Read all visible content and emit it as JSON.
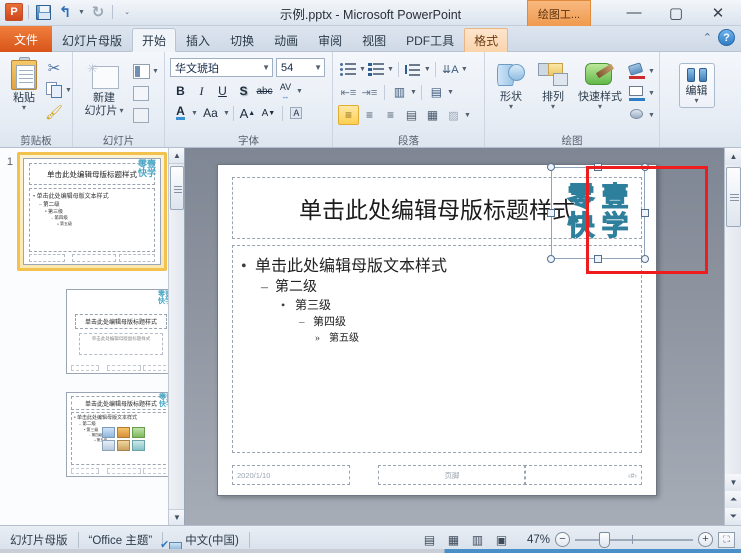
{
  "window": {
    "title": "示例.pptx  -  Microsoft PowerPoint",
    "contextual_tab_group": "绘图工...",
    "minimize": "—",
    "maximize": "▢",
    "close": "✕"
  },
  "quick_access": {
    "app_logo": "P",
    "items": [
      {
        "name": "save-icon",
        "label": "保存"
      },
      {
        "name": "undo-icon",
        "label": "撤消",
        "glyph": "↰"
      },
      {
        "name": "redo-icon",
        "label": "恢复",
        "glyph": "↻"
      },
      {
        "name": "customize-icon",
        "label": "自定义快速访问工具栏",
        "glyph": "▾"
      }
    ]
  },
  "tabs": {
    "file": "文件",
    "items": [
      {
        "label": "幻灯片母版",
        "active": false
      },
      {
        "label": "开始",
        "active": true
      },
      {
        "label": "插入",
        "active": false
      },
      {
        "label": "切换",
        "active": false
      },
      {
        "label": "动画",
        "active": false
      },
      {
        "label": "审阅",
        "active": false
      },
      {
        "label": "视图",
        "active": false
      },
      {
        "label": "PDF工具",
        "active": false
      }
    ],
    "contextual": "格式",
    "minimize_ribbon": "⌃",
    "help": "?"
  },
  "ribbon": {
    "groups": [
      {
        "name": "clipboard",
        "label": "剪贴板"
      },
      {
        "name": "slides",
        "label": "幻灯片"
      },
      {
        "name": "font",
        "label": "字体"
      },
      {
        "name": "paragraph",
        "label": "段落"
      },
      {
        "name": "drawing",
        "label": "绘图"
      },
      {
        "name": "editing",
        "label": "编辑"
      }
    ],
    "clipboard": {
      "paste_label": "粘贴",
      "paste_caret": "▾",
      "cut_icon": "✂",
      "copy_icon": "copy",
      "format_painter_icon": "brush",
      "dialog_launcher": "⌐"
    },
    "slides": {
      "new_slide_label_line1": "新建",
      "new_slide_label_line2": "幻灯片",
      "new_slide_caret": "▾",
      "layout_icon": "layout",
      "reset_icon": "reset",
      "section_icon": "section"
    },
    "font": {
      "font_name": "华文琥珀",
      "font_size": "54",
      "bold": "B",
      "italic": "I",
      "underline": "U",
      "shadow": "S",
      "strikethrough": "abc",
      "char_spacing": "AV",
      "font_color": "A",
      "change_case": "Aa",
      "grow_font": "A",
      "shrink_font": "A",
      "clear_format": "A",
      "dialog_launcher": "⌐"
    },
    "paragraph": {
      "bullets": "bullets",
      "numbering": "numbering",
      "line_spacing": "line-spacing",
      "text_direction": "text-direction",
      "decrease_indent": "decrease-indent",
      "increase_indent": "increase-indent",
      "align_columns": "columns",
      "align_text": "align-text",
      "align_left": "align-left",
      "align_center": "align-center",
      "align_right": "align-right",
      "justify": "justify",
      "smartart": "smartart",
      "convert_smartart": "convert-smartart",
      "dialog_launcher": "⌐"
    },
    "drawing": {
      "shapes_label": "形状",
      "arrange_label": "排列",
      "quickstyles_label": "快速样式",
      "caret": "▾",
      "shape_fill": "shape-fill",
      "shape_outline": "shape-outline",
      "shape_effects": "shape-effects",
      "dialog_launcher": "⌐"
    },
    "editing": {
      "label": "编辑",
      "caret": "▾"
    }
  },
  "slide_panel": {
    "thumbnails": [
      {
        "number": "1",
        "selected": true,
        "kind": "master"
      },
      {
        "number": "",
        "selected": false,
        "kind": "title"
      },
      {
        "number": "",
        "selected": false,
        "kind": "content"
      }
    ],
    "scroll_up": "▲",
    "scroll_down": "▼"
  },
  "slide": {
    "title_placeholder": "单击此处编辑母版标题样式",
    "body_levels": [
      {
        "bullet": "•",
        "text": "单击此处编辑母版文本样式",
        "level": 1
      },
      {
        "bullet": "–",
        "text": "第二级",
        "level": 2
      },
      {
        "bullet": "•",
        "text": "第三级",
        "level": 3
      },
      {
        "bullet": "–",
        "text": "第四级",
        "level": 4
      },
      {
        "bullet": "»",
        "text": "第五级",
        "level": 5
      }
    ],
    "footer_date": "2020/1/10",
    "footer_text": "页脚",
    "footer_number": "‹#›",
    "logo_chars": [
      "零",
      "壹",
      "快",
      "学"
    ],
    "logo_color": "#4aa8c6",
    "selection_highlight_color": "#ee1c1c"
  },
  "editor_scroll": {
    "up": "▲",
    "down": "▼",
    "prev_slide": "⌃",
    "next_slide": "⌄"
  },
  "status_bar": {
    "view_name": "幻灯片母版",
    "theme_name": "“Office 主题”",
    "language": "中文(中国)",
    "spellcheck_icon": "spellcheck",
    "view_buttons": [
      {
        "name": "normal-view",
        "glyph": "▤",
        "active": false
      },
      {
        "name": "slide-sorter-view",
        "glyph": "▦",
        "active": false
      },
      {
        "name": "reading-view",
        "glyph": "▥",
        "active": false
      },
      {
        "name": "slideshow-view",
        "glyph": "▣",
        "active": false
      }
    ],
    "zoom_level": "47%",
    "zoom_out": "−",
    "zoom_in": "+",
    "fit_to_window": "⛶"
  }
}
